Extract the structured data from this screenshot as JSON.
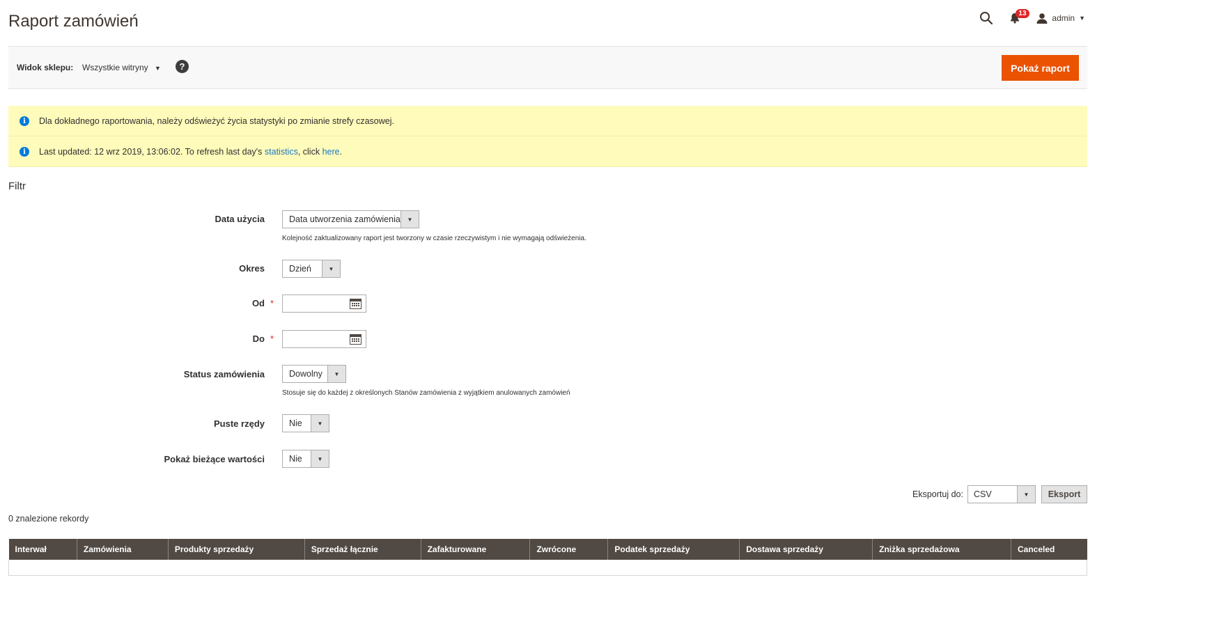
{
  "page": {
    "title": "Raport zamówień"
  },
  "header": {
    "notifications_count": "13",
    "user": "admin",
    "icons": {
      "search": "search-icon",
      "bell": "bell-icon",
      "user": "user-icon"
    }
  },
  "toolbar": {
    "store_label": "Widok sklepu:",
    "store_value": "Wszystkie witryny",
    "help": "?",
    "show_report": "Pokaż raport"
  },
  "messages": [
    {
      "text": "Dla dokładnego raportowania, należy odświeżyć życia statystyki po zmianie strefy czasowej."
    },
    {
      "prefix": "Last updated: 12 wrz 2019, 13:06:02. To refresh last day's ",
      "link1": "statistics",
      "mid": ", click ",
      "link2": "here",
      "suffix": "."
    }
  ],
  "filter": {
    "title": "Filtr",
    "date_used": {
      "label": "Data użycia",
      "value": "Data utworzenia zamówienia",
      "note": "Kolejność zaktualizowany raport jest tworzony w czasie rzeczywistym i nie wymagają odświeżenia."
    },
    "period": {
      "label": "Okres",
      "value": "Dzień"
    },
    "from": {
      "label": "Od",
      "required": "*",
      "value": ""
    },
    "to": {
      "label": "Do",
      "required": "*",
      "value": ""
    },
    "order_status": {
      "label": "Status zamówienia",
      "value": "Dowolny",
      "note": "Stosuje się do każdej z określonych Stanów zamówienia z wyjątkiem anulowanych zamówień"
    },
    "empty_rows": {
      "label": "Puste rzędy",
      "value": "Nie"
    },
    "show_actual": {
      "label": "Pokaż bieżące wartości",
      "value": "Nie"
    }
  },
  "export": {
    "label": "Eksportuj do:",
    "format": "CSV",
    "button": "Eksport"
  },
  "records": "0 znalezione rekordy",
  "grid": {
    "columns": [
      "Interwał",
      "Zamówienia",
      "Produkty sprzedaży",
      "Sprzedaż łącznie",
      "Zafakturowane",
      "Zwrócone",
      "Podatek sprzedaży",
      "Dostawa sprzedaży",
      "Zniżka sprzedażowa",
      "Canceled"
    ]
  }
}
